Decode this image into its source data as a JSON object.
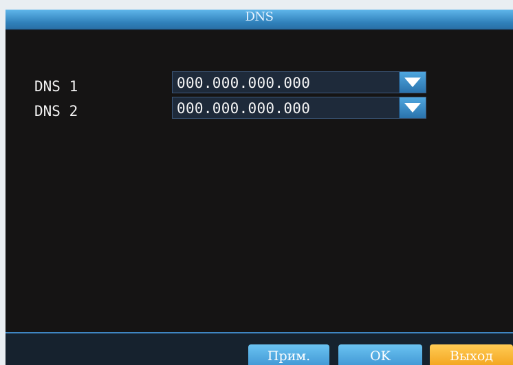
{
  "window": {
    "title": "DNS"
  },
  "dns_rows": [
    {
      "label": "DNS 1",
      "value": "000.000.000.000"
    },
    {
      "label": "DNS 2",
      "value": "000.000.000.000"
    }
  ],
  "buttons": {
    "apply": "Прим.",
    "ok": "OK",
    "exit": "Выход"
  },
  "icons": {
    "dropdown": "chevron-down-icon"
  },
  "colors": {
    "titlebar": "#3b92cf",
    "background": "#151414",
    "button_blue": "#4ea7dd",
    "button_exit": "#f5b232"
  }
}
